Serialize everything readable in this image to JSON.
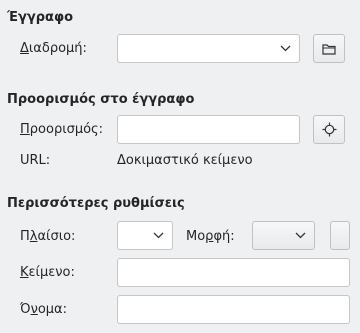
{
  "document_section": {
    "title": "Έγγραφο",
    "path_label_mnemonic": "Δ",
    "path_label_rest": "ιαδρομή:",
    "path_value": "",
    "open_button_icon": "folder-icon"
  },
  "target_section": {
    "title": "Προορισμός στο έγγραφο",
    "target_label_mnemonic": "Π",
    "target_label_rest": "ροορισμός:",
    "target_value": "",
    "target_button_icon": "crosshair-icon",
    "url_label": "URL:",
    "url_value": "Δοκιμαστικό κείμενο"
  },
  "more_settings": {
    "title": "Περισσότερες ρυθμίσεις",
    "frame_label_mnemonic": "λ",
    "frame_label_before": "Π",
    "frame_label_after": "αίσιο:",
    "frame_value": "",
    "format_label_mnemonic": "ρ",
    "format_label_before": "Μο",
    "format_label_after": "φή:",
    "format_value": "",
    "text_label_mnemonic": "Κ",
    "text_label_rest": "είμενο:",
    "text_value": "",
    "name_label_before": "Ό",
    "name_label_mnemonic": "ν",
    "name_label_after": "ομα:",
    "name_value": ""
  }
}
